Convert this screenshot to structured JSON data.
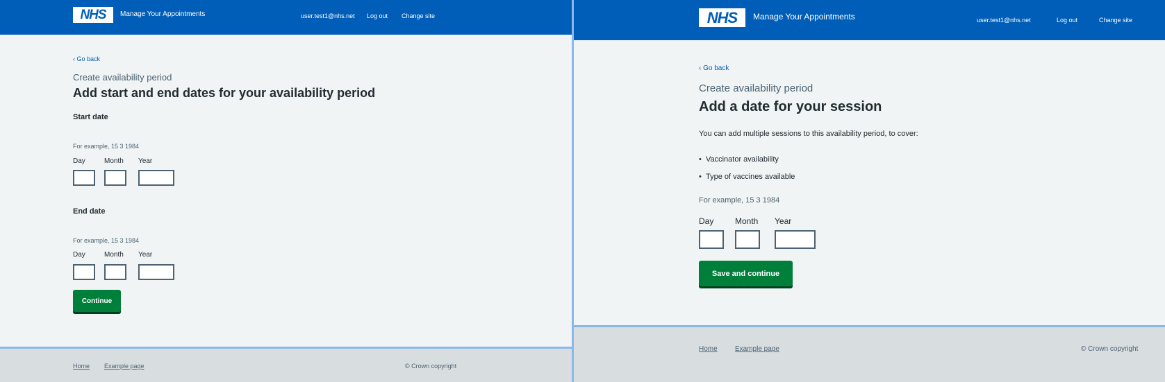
{
  "left": {
    "header": {
      "logo": "NHS",
      "service_name": "Manage Your Appointments",
      "user_email": "user.test1@nhs.net",
      "logout_label": "Log out",
      "change_site_label": "Change site"
    },
    "back_label": "Go back",
    "caption": "Create availability period",
    "title": "Add start and end dates for your availability period",
    "start_date": {
      "legend": "Start date",
      "hint": "For example, 15 3 1984",
      "day_label": "Day",
      "month_label": "Month",
      "year_label": "Year",
      "day_value": "",
      "month_value": "",
      "year_value": ""
    },
    "end_date": {
      "legend": "End date",
      "hint": "For example, 15 3 1984",
      "day_label": "Day",
      "month_label": "Month",
      "year_label": "Year",
      "day_value": "",
      "month_value": "",
      "year_value": ""
    },
    "continue_label": "Continue",
    "footer": {
      "links": [
        "Home",
        "Example page"
      ],
      "copyright": "© Crown copyright"
    }
  },
  "right": {
    "header": {
      "logo": "NHS",
      "service_name": "Manage Your Appointments",
      "user_email": "user.test1@nhs.net",
      "logout_label": "Log out",
      "change_site_label": "Change site"
    },
    "back_label": "Go back",
    "caption": "Create availability period",
    "title": "Add a date for your session",
    "intro": "You can add multiple sessions to this availability period, to cover:",
    "bullets": [
      "Vaccinator availability",
      "Type of vaccines available"
    ],
    "hint": "For example, 15 3 1984",
    "day_label": "Day",
    "month_label": "Month",
    "year_label": "Year",
    "day_value": "",
    "month_value": "",
    "year_value": "",
    "save_label": "Save and continue",
    "footer": {
      "links": [
        "Home",
        "Example page"
      ],
      "copyright": "© Crown copyright"
    }
  },
  "colors": {
    "nhs_blue": "#005eb8",
    "button_green": "#007f3b",
    "page_background": "#f0f4f5",
    "footer_background": "#d8dde0",
    "text": "#212b32",
    "secondary_text": "#4c6272"
  }
}
